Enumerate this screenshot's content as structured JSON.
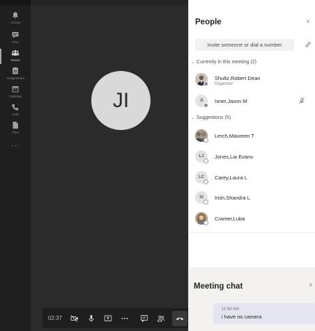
{
  "rail": {
    "items": [
      {
        "label": "Activity",
        "icon": "bell-icon"
      },
      {
        "label": "Chat",
        "icon": "chat-icon"
      },
      {
        "label": "Teams",
        "icon": "teams-icon"
      },
      {
        "label": "Assignments",
        "icon": "assignments-icon"
      },
      {
        "label": "Calendar",
        "icon": "calendar-icon"
      },
      {
        "label": "Calls",
        "icon": "phone-icon"
      },
      {
        "label": "Files",
        "icon": "files-icon"
      }
    ],
    "more": "···"
  },
  "stage": {
    "avatar_initials": "JI"
  },
  "call_bar": {
    "timer": "02:37",
    "buttons": [
      "camera-off-icon",
      "microphone-icon",
      "share-screen-icon",
      "more-options-icon",
      "conversation-icon",
      "participants-icon",
      "hang-up-icon"
    ]
  },
  "people": {
    "title": "People",
    "close": "×",
    "invite_placeholder": "Invite someone or dial a number",
    "in_meeting_header": "Currently in this meeting (2)",
    "in_meeting": [
      {
        "name": "Shultz,Robert Dean",
        "role": "Organizer",
        "initials": ""
      },
      {
        "name": "Isner,Jason M",
        "role": "",
        "initials": "JI"
      }
    ],
    "suggestions_header": "Suggestions (5)",
    "suggestions": [
      {
        "name": "Lerch,Maureen T",
        "initials": ""
      },
      {
        "name": "Jones,Lia Evans",
        "initials": "LJ"
      },
      {
        "name": "Carey,Laura L",
        "initials": "LC"
      },
      {
        "name": "Irish,Shandra L",
        "initials": "SI"
      },
      {
        "name": "Cramer,Luba",
        "initials": ""
      }
    ]
  },
  "chat": {
    "title": "Meeting chat",
    "close": "×",
    "message_time": "11:56 AM",
    "message_text": "i have no camera"
  }
}
